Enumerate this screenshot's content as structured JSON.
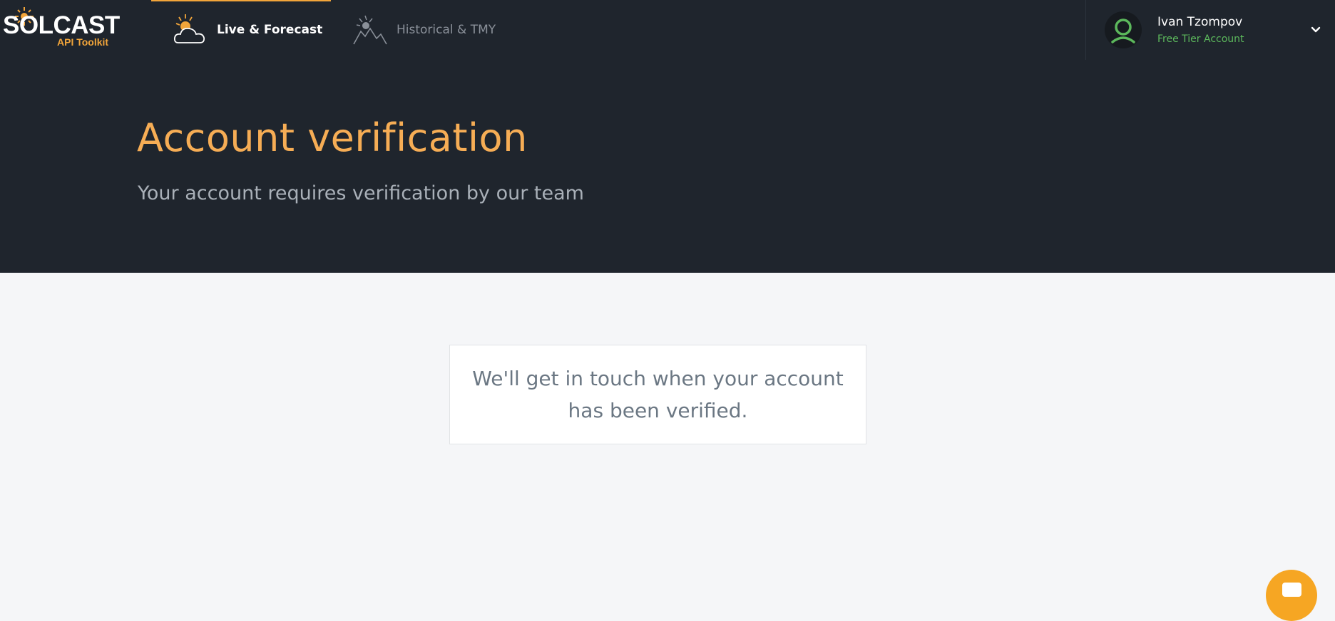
{
  "brand": {
    "name": "SOLCAST",
    "subtitle": "API Toolkit",
    "accent_color": "#f2a53a"
  },
  "nav": {
    "items": [
      {
        "label": "Live & Forecast",
        "icon": "sun-cloud-icon",
        "active": true
      },
      {
        "label": "Historical & TMY",
        "icon": "sun-mountain-icon",
        "active": false
      }
    ]
  },
  "user": {
    "name": "Ivan Tzompov",
    "tier": "Free Tier Account",
    "avatar_icon": "user-avatar-icon",
    "menu_icon": "chevron-down-icon"
  },
  "hero": {
    "title": "Account verification",
    "subtitle": "Your account requires verification by our team"
  },
  "message": {
    "text": "We'll get in touch when your account has been verified."
  },
  "chat": {
    "icon": "chat-icon",
    "color": "#f6a623"
  }
}
